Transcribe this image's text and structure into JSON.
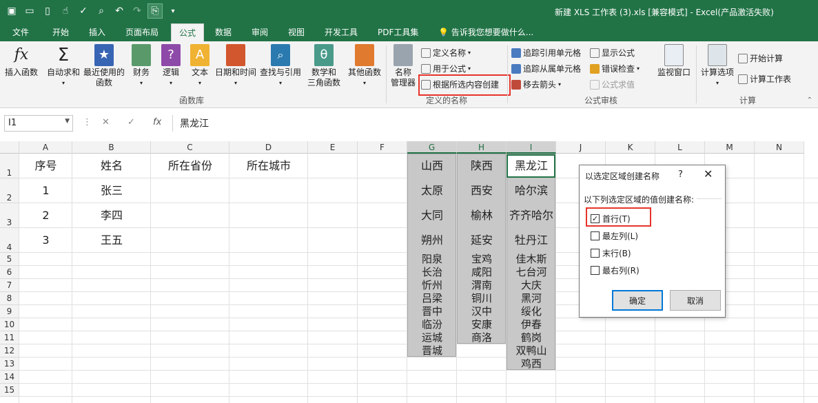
{
  "window": {
    "title": "新建 XLS 工作表 (3).xls  [兼容模式] - Excel(产品激活失败)"
  },
  "ribbon_tabs": [
    {
      "label": "文件",
      "active": false
    },
    {
      "label": "开始",
      "active": false
    },
    {
      "label": "插入",
      "active": false
    },
    {
      "label": "页面布局",
      "active": false
    },
    {
      "label": "公式",
      "active": true
    },
    {
      "label": "数据",
      "active": false
    },
    {
      "label": "审阅",
      "active": false
    },
    {
      "label": "视图",
      "active": false
    },
    {
      "label": "开发工具",
      "active": false
    },
    {
      "label": "PDF工具集",
      "active": false
    }
  ],
  "tell_me": "告诉我您想要做什么...",
  "ribbon": {
    "insert_function": "插入函数",
    "autosum": "自动求和",
    "recent": "最近使用的",
    "recent2": "函数",
    "financial": "财务",
    "logical": "逻辑",
    "text": "文本",
    "datetime": "日期和时间",
    "lookup": "查找与引用",
    "math": "数学和",
    "math2": "三角函数",
    "more": "其他函数",
    "library_group": "函数库",
    "name_manager": "名称",
    "name_manager2": "管理器",
    "define_name": "定义名称",
    "use_in_formula": "用于公式",
    "create_from_selection": "根据所选内容创建",
    "defined_names_group": "定义的名称",
    "trace_precedents": "追踪引用单元格",
    "trace_dependents": "追踪从属单元格",
    "remove_arrows": "移去箭头",
    "show_formulas": "显示公式",
    "error_checking": "错误检查",
    "evaluate": "公式求值",
    "auditing_group": "公式审核",
    "watch_window": "监视窗口",
    "calc_options": "计算选项",
    "calc_now": "开始计算",
    "calc_sheet": "计算工作表",
    "calc_group": "计算"
  },
  "formula_bar": {
    "name_box": "I1",
    "fx": "fx",
    "value": "黑龙江"
  },
  "columns": [
    "A",
    "B",
    "C",
    "D",
    "E",
    "F",
    "G",
    "H",
    "I",
    "J",
    "K",
    "L",
    "M",
    "N"
  ],
  "rows": [
    "1",
    "2",
    "3",
    "4",
    "5",
    "6",
    "7",
    "8",
    "9",
    "10",
    "11",
    "12",
    "13",
    "14",
    "15"
  ],
  "cells": {
    "A": [
      "序号",
      "1",
      "2",
      "3"
    ],
    "B": [
      "姓名",
      "张三",
      "李四",
      "王五"
    ],
    "C": [
      "所在省份"
    ],
    "D": [
      "所在城市"
    ],
    "G": [
      "山西",
      "太原",
      "大同",
      "朔州",
      "阳泉",
      "长治",
      "忻州",
      "吕梁",
      "晋中",
      "临汾",
      "运城",
      "晋城"
    ],
    "H": [
      "陕西",
      "西安",
      "榆林",
      "延安",
      "宝鸡",
      "咸阳",
      "渭南",
      "铜川",
      "汉中",
      "安康",
      "商洛"
    ],
    "I": [
      "黑龙江",
      "哈尔滨",
      "齐齐哈尔",
      "牡丹江",
      "佳木斯",
      "七台河",
      "大庆",
      "黑河",
      "绥化",
      "伊春",
      "鹤岗",
      "双鸭山",
      "鸡西"
    ]
  },
  "dialog": {
    "title": "以选定区域创建名称",
    "help": "?",
    "close": "✕",
    "prompt": "以下列选定区域的值创建名称:",
    "options": [
      {
        "label": "首行(T)",
        "checked": true
      },
      {
        "label": "最左列(L)",
        "checked": false
      },
      {
        "label": "末行(B)",
        "checked": false
      },
      {
        "label": "最右列(R)",
        "checked": false
      }
    ],
    "ok": "确定",
    "cancel": "取消"
  },
  "colors": {
    "excel_green": "#217346",
    "highlight_red": "#e6332a",
    "selection_gray": "#c8c8c8"
  }
}
